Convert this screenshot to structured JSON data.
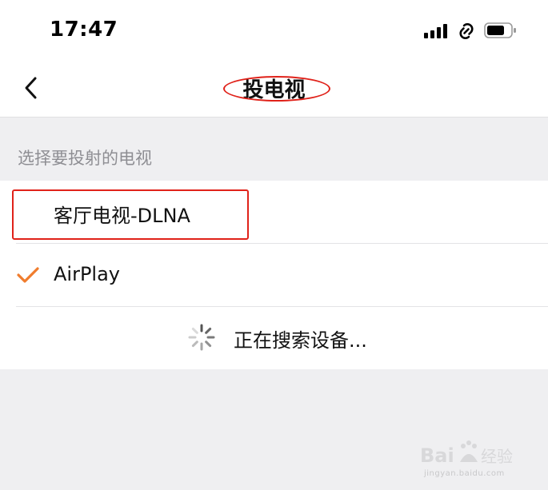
{
  "status_bar": {
    "time": "17:47",
    "icons": [
      "cellular-signal-icon",
      "personal-hotspot-icon",
      "battery-icon"
    ]
  },
  "nav": {
    "back_icon": "chevron-left-icon",
    "title": "投电视"
  },
  "section": {
    "header": "选择要投射的电视"
  },
  "devices": [
    {
      "label": "客厅电视-DLNA",
      "selected": false
    },
    {
      "label": "AirPlay",
      "selected": true,
      "icon": "checkmark-icon"
    }
  ],
  "searching": {
    "label": "正在搜索设备...",
    "icon": "loading-spinner-icon"
  },
  "colors": {
    "accent": "#f07c2d",
    "annotation": "#e0221a",
    "background": "#efeff1",
    "secondary_text": "#8e8e93"
  },
  "watermark": {
    "brand": "Baidu经验",
    "url": "jingyan.baidu.com"
  }
}
